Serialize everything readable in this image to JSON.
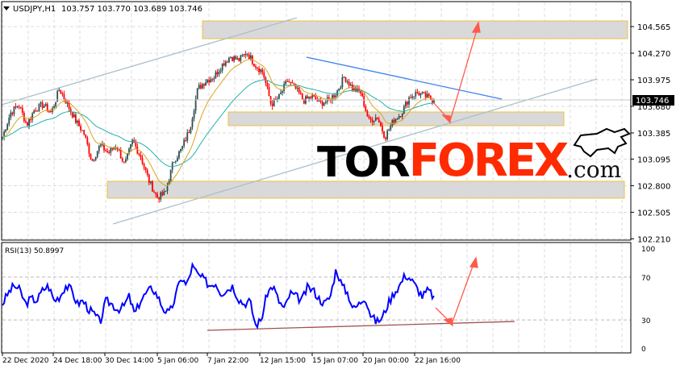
{
  "header": {
    "symbol": "USDJPY,H1",
    "ohlc": "103.757 103.770 103.689 103.746"
  },
  "rsi_header": {
    "label": "RSI(13) 50.8997"
  },
  "logo": {
    "tor": "TOR",
    "forex": "FOREX",
    "com": ".com"
  },
  "colors": {
    "bull": "#2f4f4f",
    "bear": "#ff0000",
    "ma_fast": "#daa520",
    "ma_slow": "#20b2aa",
    "rsi": "#0000ff",
    "forecast": "#ff5a4a"
  },
  "chart_data": [
    {
      "type": "line",
      "title": "USDJPY,H1",
      "current_price": 103.746,
      "yticks": [
        104.565,
        104.27,
        103.975,
        103.68,
        103.385,
        103.095,
        102.8,
        102.505,
        102.21
      ],
      "ylim": [
        102.19,
        104.86
      ],
      "xticks": [
        "22 Dec 2020",
        "24 Dec 18:00",
        "30 Dec 14:00",
        "5 Jan 06:00",
        "7 Jan 22:00",
        "12 Jan 15:00",
        "15 Jan 07:00",
        "20 Jan 00:00",
        "22 Jan 16:00"
      ],
      "series": [
        {
          "name": "USDJPY close",
          "values": [
            103.34,
            103.608,
            103.698,
            103.474,
            103.653,
            103.698,
            103.608,
            103.877,
            103.698,
            103.519,
            103.385,
            103.072,
            103.251,
            103.161,
            103.251,
            103.027,
            103.296,
            103.117,
            102.849,
            102.67,
            102.714,
            103.072,
            103.206,
            103.43,
            103.877,
            103.966,
            104.011,
            104.145,
            104.234,
            104.19,
            104.279,
            104.145,
            104.055,
            103.698,
            103.787,
            103.966,
            103.877,
            103.743,
            103.787,
            103.716,
            103.743,
            103.832,
            104.011,
            103.877,
            103.832,
            103.519,
            103.564,
            103.34,
            103.519,
            103.608,
            103.787,
            103.832,
            103.787,
            103.746
          ]
        }
      ]
    },
    {
      "type": "line",
      "title": "RSI(13) 50.8997",
      "yticks": [
        100,
        70,
        30,
        0
      ],
      "ylim": [
        0,
        100
      ],
      "series": [
        {
          "name": "RSI(13)",
          "values": [
            45,
            55,
            62,
            58,
            45,
            50,
            48,
            58,
            62,
            48,
            52,
            62,
            58,
            45,
            48,
            40,
            35,
            28,
            48,
            45,
            40,
            42,
            52,
            35,
            48,
            55,
            60,
            52,
            40,
            36,
            50,
            70,
            62,
            80,
            72,
            68,
            62,
            65,
            55,
            58,
            62,
            50,
            45,
            48,
            25,
            30,
            55,
            62,
            48,
            40,
            55,
            52,
            48,
            60,
            58,
            50,
            45,
            52,
            78,
            62,
            55,
            40,
            45,
            52,
            35,
            28,
            32,
            45,
            55,
            62,
            72,
            68,
            60,
            52,
            58,
            51
          ]
        }
      ]
    }
  ]
}
